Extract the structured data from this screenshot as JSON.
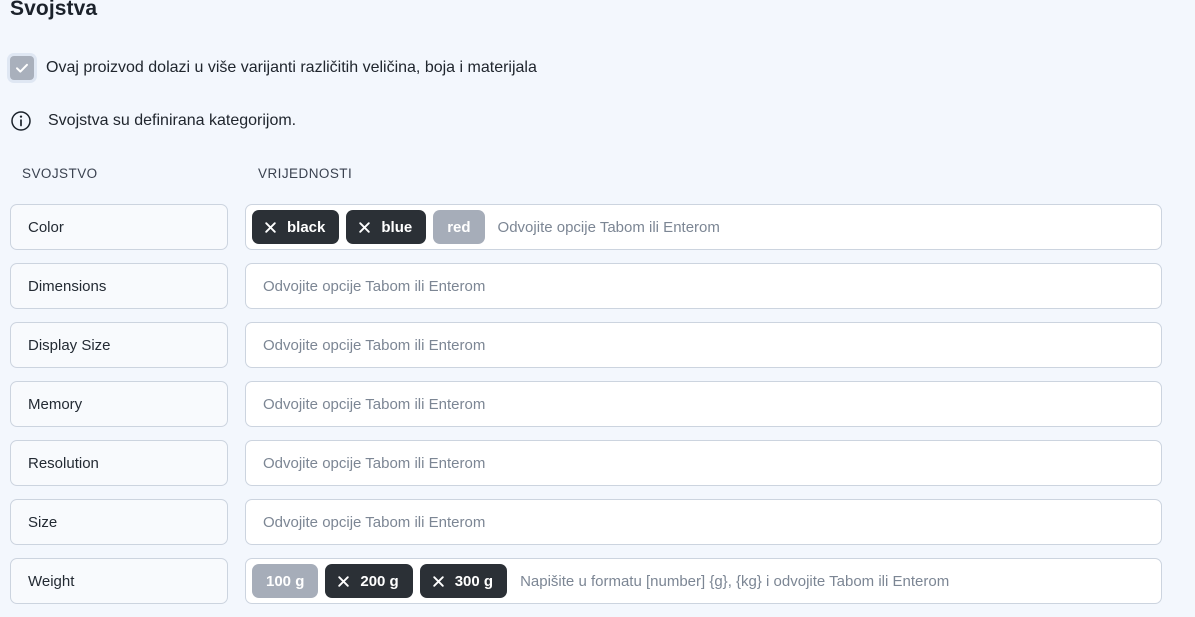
{
  "section": {
    "title": "Svojstva"
  },
  "variant_checkbox": {
    "label": "Ovaj proizvod dolazi u više varijanti različitih veličina, boja i materijala",
    "checked": true,
    "disabled": true
  },
  "note": {
    "icon": "info-icon",
    "text": "Svojstva su definirana kategorijom."
  },
  "table": {
    "headers": {
      "property": "SVOJSTVO",
      "values": "VRIJEDNOSTI"
    },
    "placeholders": {
      "default": "Odvojite opcije Tabom ili Enterom",
      "weight": "Napišite u formatu [number] {g}, {kg} i odvojite Tabom ili Enterom"
    },
    "rows": [
      {
        "name": "Color",
        "placeholder": "Odvojite opcije Tabom ili Enterom",
        "chips": [
          {
            "label": "black",
            "removable": true,
            "style": "dark"
          },
          {
            "label": "blue",
            "removable": true,
            "style": "dark"
          },
          {
            "label": "red",
            "removable": false,
            "style": "muted"
          }
        ]
      },
      {
        "name": "Dimensions",
        "placeholder": "Odvojite opcije Tabom ili Enterom",
        "chips": []
      },
      {
        "name": "Display Size",
        "placeholder": "Odvojite opcije Tabom ili Enterom",
        "chips": []
      },
      {
        "name": "Memory",
        "placeholder": "Odvojite opcije Tabom ili Enterom",
        "chips": []
      },
      {
        "name": "Resolution",
        "placeholder": "Odvojite opcije Tabom ili Enterom",
        "chips": []
      },
      {
        "name": "Size",
        "placeholder": "Odvojite opcije Tabom ili Enterom",
        "chips": []
      },
      {
        "name": "Weight",
        "placeholder": "Napišite u formatu [number] {g}, {kg} i odvojite Tabom ili Enterom",
        "chips": [
          {
            "label": "100 g",
            "removable": false,
            "style": "muted"
          },
          {
            "label": "200 g",
            "removable": true,
            "style": "dark"
          },
          {
            "label": "300 g",
            "removable": true,
            "style": "dark"
          }
        ]
      }
    ]
  },
  "colors": {
    "page_background": "#f3f7fd",
    "chip_dark": "#2b3036",
    "chip_muted": "#a6adb9",
    "field_border": "#ccd4df",
    "label_background": "#f8fafd",
    "text_primary": "#20262e",
    "text_placeholder": "#7c8694"
  }
}
